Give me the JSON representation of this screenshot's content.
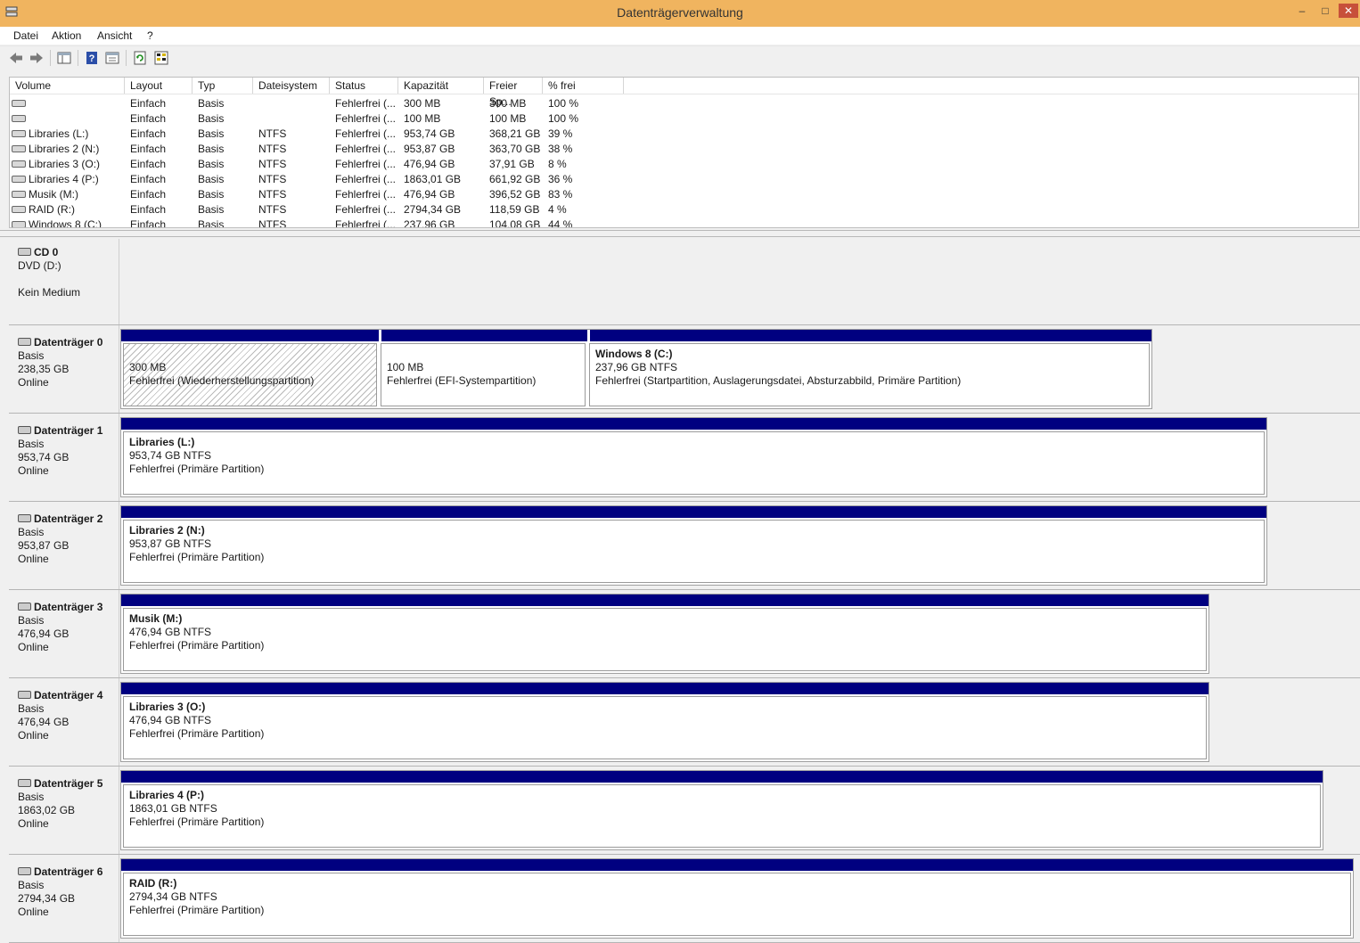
{
  "window": {
    "title": "Datenträgerverwaltung"
  },
  "menu": [
    "Datei",
    "Aktion",
    "Ansicht",
    "?"
  ],
  "toolbar": [
    "back-icon",
    "forward-icon",
    "show-hide-console-tree-icon",
    "help-icon",
    "properties-icon",
    "refresh-icon",
    "export-list-icon"
  ],
  "columns": [
    "Volume",
    "Layout",
    "Typ",
    "Dateisystem",
    "Status",
    "Kapazität",
    "Freier Sp...",
    "% frei"
  ],
  "volumes": [
    {
      "volume": "",
      "layout": "Einfach",
      "typ": "Basis",
      "fs": "",
      "status": "Fehlerfrei (...",
      "cap": "300 MB",
      "free": "300 MB",
      "pct": "100 %"
    },
    {
      "volume": "",
      "layout": "Einfach",
      "typ": "Basis",
      "fs": "",
      "status": "Fehlerfrei (...",
      "cap": "100 MB",
      "free": "100 MB",
      "pct": "100 %"
    },
    {
      "volume": "Libraries (L:)",
      "layout": "Einfach",
      "typ": "Basis",
      "fs": "NTFS",
      "status": "Fehlerfrei (...",
      "cap": "953,74 GB",
      "free": "368,21 GB",
      "pct": "39 %"
    },
    {
      "volume": "Libraries 2 (N:)",
      "layout": "Einfach",
      "typ": "Basis",
      "fs": "NTFS",
      "status": "Fehlerfrei (...",
      "cap": "953,87 GB",
      "free": "363,70 GB",
      "pct": "38 %"
    },
    {
      "volume": "Libraries 3 (O:)",
      "layout": "Einfach",
      "typ": "Basis",
      "fs": "NTFS",
      "status": "Fehlerfrei (...",
      "cap": "476,94 GB",
      "free": "37,91 GB",
      "pct": "8 %"
    },
    {
      "volume": "Libraries 4 (P:)",
      "layout": "Einfach",
      "typ": "Basis",
      "fs": "NTFS",
      "status": "Fehlerfrei (...",
      "cap": "1863,01 GB",
      "free": "661,92 GB",
      "pct": "36 %"
    },
    {
      "volume": "Musik (M:)",
      "layout": "Einfach",
      "typ": "Basis",
      "fs": "NTFS",
      "status": "Fehlerfrei (...",
      "cap": "476,94 GB",
      "free": "396,52 GB",
      "pct": "83 %"
    },
    {
      "volume": "RAID (R:)",
      "layout": "Einfach",
      "typ": "Basis",
      "fs": "NTFS",
      "status": "Fehlerfrei (...",
      "cap": "2794,34 GB",
      "free": "118,59 GB",
      "pct": "4 %"
    },
    {
      "volume": "Windows 8 (C:)",
      "layout": "Einfach",
      "typ": "Basis",
      "fs": "NTFS",
      "status": "Fehlerfrei (...",
      "cap": "237,96 GB",
      "free": "104,08 GB",
      "pct": "44 %"
    }
  ],
  "cdrom": {
    "name": "CD 0",
    "drive": "DVD (D:)",
    "media": "Kein Medium"
  },
  "disks": [
    {
      "name": "Datenträger 0",
      "type": "Basis",
      "size": "238,35 GB",
      "state": "Online",
      "partitions": [
        {
          "title": "",
          "size": "300 MB",
          "status": "Fehlerfrei (Wiederherstellungspartition)"
        },
        {
          "title": "",
          "size": "100 MB",
          "status": "Fehlerfrei (EFI-Systempartition)"
        },
        {
          "title": "Windows 8  (C:)",
          "size": "237,96 GB NTFS",
          "status": "Fehlerfrei (Startpartition, Auslagerungsdatei, Absturzabbild, Primäre Partition)"
        }
      ]
    },
    {
      "name": "Datenträger 1",
      "type": "Basis",
      "size": "953,74 GB",
      "state": "Online",
      "partitions": [
        {
          "title": "Libraries  (L:)",
          "size": "953,74 GB NTFS",
          "status": "Fehlerfrei (Primäre Partition)"
        }
      ]
    },
    {
      "name": "Datenträger 2",
      "type": "Basis",
      "size": "953,87 GB",
      "state": "Online",
      "partitions": [
        {
          "title": "Libraries 2  (N:)",
          "size": "953,87 GB NTFS",
          "status": "Fehlerfrei (Primäre Partition)"
        }
      ]
    },
    {
      "name": "Datenträger 3",
      "type": "Basis",
      "size": "476,94 GB",
      "state": "Online",
      "partitions": [
        {
          "title": "Musik  (M:)",
          "size": "476,94 GB NTFS",
          "status": "Fehlerfrei (Primäre Partition)"
        }
      ]
    },
    {
      "name": "Datenträger 4",
      "type": "Basis",
      "size": "476,94 GB",
      "state": "Online",
      "partitions": [
        {
          "title": "Libraries 3  (O:)",
          "size": "476,94 GB NTFS",
          "status": "Fehlerfrei (Primäre Partition)"
        }
      ]
    },
    {
      "name": "Datenträger 5",
      "type": "Basis",
      "size": "1863,02 GB",
      "state": "Online",
      "partitions": [
        {
          "title": "Libraries 4  (P:)",
          "size": "1863,01 GB NTFS",
          "status": "Fehlerfrei (Primäre Partition)"
        }
      ]
    },
    {
      "name": "Datenträger 6",
      "type": "Basis",
      "size": "2794,34 GB",
      "state": "Online",
      "partitions": [
        {
          "title": "RAID  (R:)",
          "size": "2794,34 GB NTFS",
          "status": "Fehlerfrei (Primäre Partition)"
        }
      ]
    }
  ]
}
